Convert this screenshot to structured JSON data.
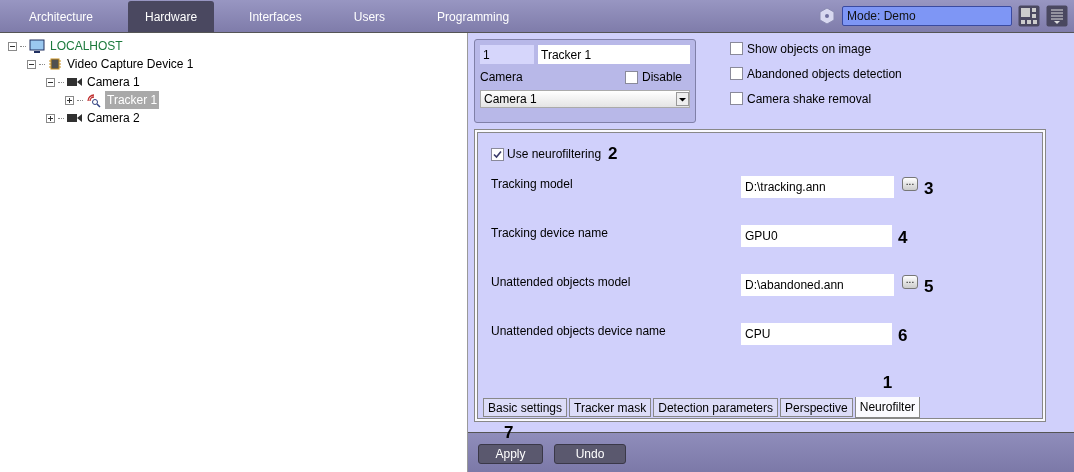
{
  "nav_tabs": [
    {
      "label": "Architecture",
      "selected": false
    },
    {
      "label": "Hardware",
      "selected": true
    },
    {
      "label": "Interfaces",
      "selected": false
    },
    {
      "label": "Users",
      "selected": false
    },
    {
      "label": "Programming",
      "selected": false
    }
  ],
  "mode": {
    "value": "Mode: Demo"
  },
  "tree": [
    {
      "label": "LOCALHOST",
      "kind": "computer",
      "expanded": true,
      "selected": false,
      "children": [
        {
          "label": "Video Capture Device 1",
          "kind": "chip",
          "expanded": true,
          "selected": false,
          "children": [
            {
              "label": "Camera 1",
              "kind": "camera",
              "expanded": true,
              "selected": false,
              "children": [
                {
                  "label": "Tracker 1",
                  "kind": "tracker",
                  "expanded": false,
                  "selected": true
                }
              ]
            },
            {
              "label": "Camera 2",
              "kind": "camera",
              "expanded": false,
              "selected": false
            }
          ]
        }
      ]
    }
  ],
  "object": {
    "id": "1",
    "name": "Tracker 1",
    "camera_label": "Camera",
    "disable": {
      "label": "Disable",
      "checked": false
    },
    "camera": "Camera 1"
  },
  "options": [
    {
      "label": "Show objects on image",
      "checked": false
    },
    {
      "label": "Abandoned objects detection",
      "checked": false
    },
    {
      "label": "Camera shake removal",
      "checked": false
    }
  ],
  "neurofilter": {
    "use": {
      "label": "Use neurofiltering",
      "checked": true,
      "callout": "2"
    },
    "fields": [
      {
        "label": "Tracking model",
        "value": "D:\\tracking.ann",
        "browse": "...",
        "callout": "3"
      },
      {
        "label": "Tracking device name",
        "value": "GPU0",
        "callout": "4"
      },
      {
        "label": "Unattended objects model",
        "value": "D:\\abandoned.ann",
        "browse": "...",
        "callout": "5"
      },
      {
        "label": "Unattended objects device name",
        "value": "CPU",
        "callout": "6"
      }
    ]
  },
  "settings_tabs": [
    {
      "label": "Basic settings",
      "selected": false
    },
    {
      "label": "Tracker mask",
      "selected": false
    },
    {
      "label": "Detection parameters",
      "selected": false
    },
    {
      "label": "Perspective",
      "selected": false
    },
    {
      "label": "Neurofilter",
      "selected": true,
      "callout": "1"
    }
  ],
  "buttons": [
    {
      "label": "Apply",
      "callout": "7"
    },
    {
      "label": "Undo"
    }
  ]
}
